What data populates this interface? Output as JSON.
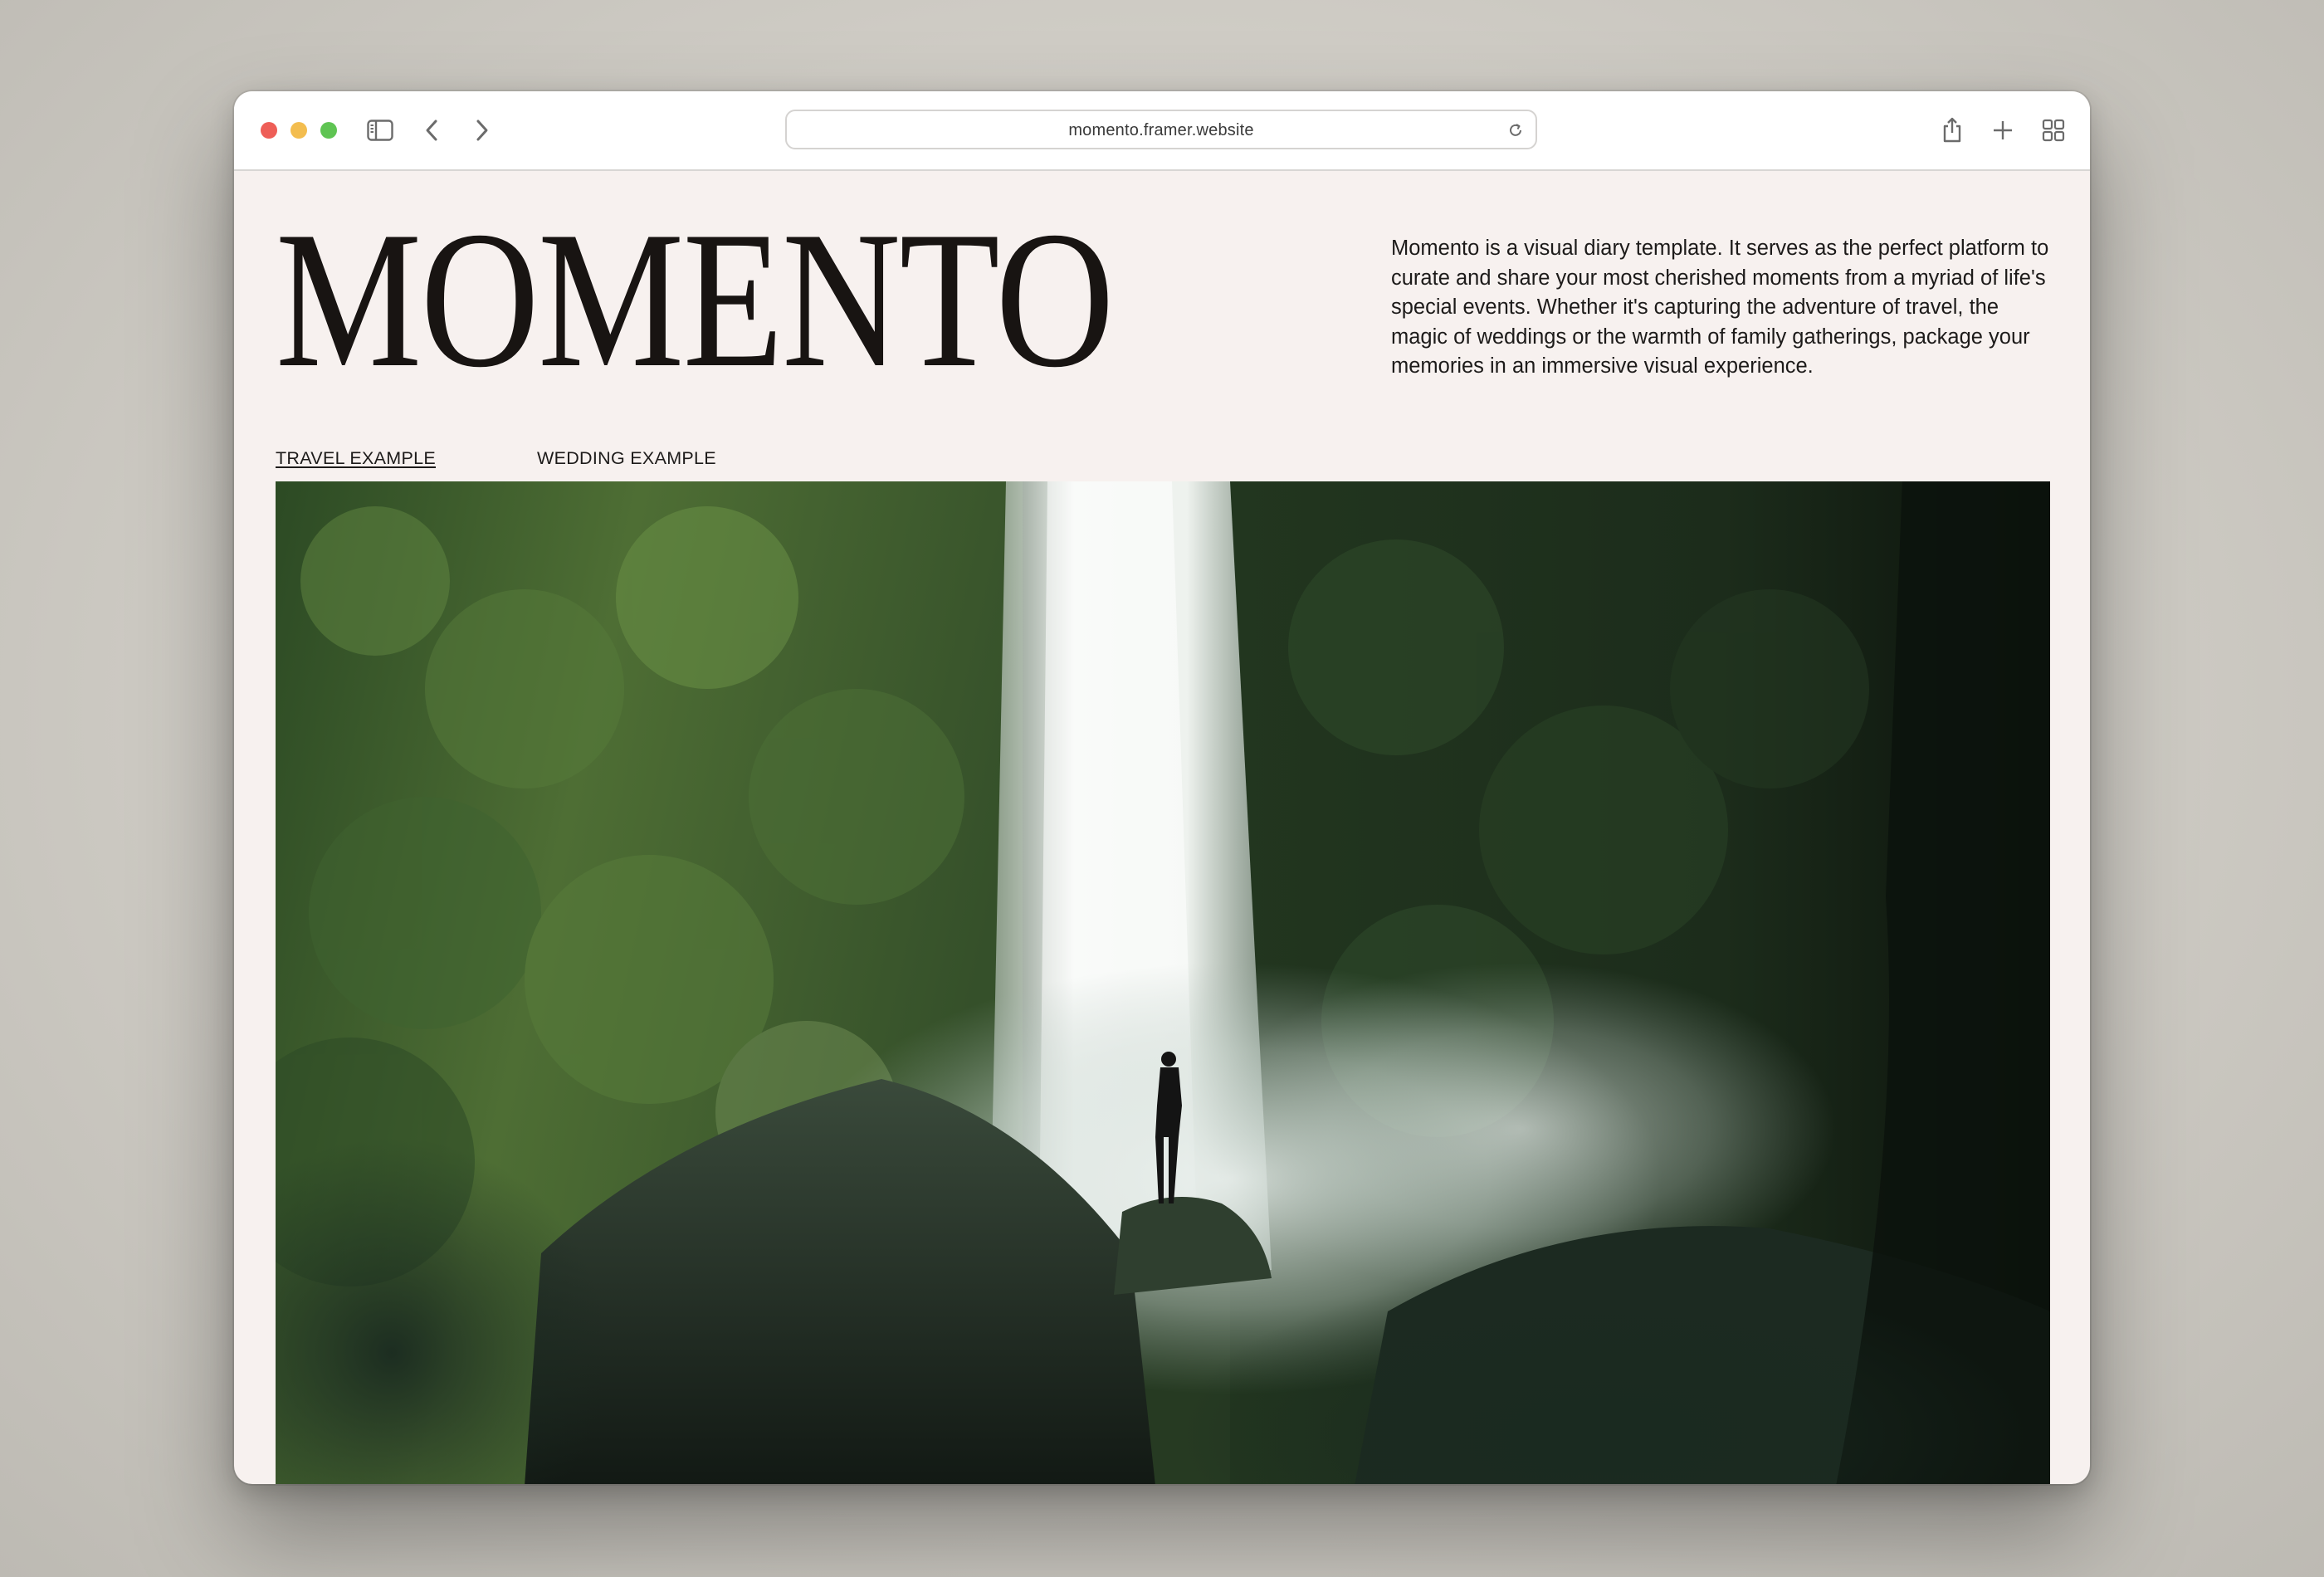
{
  "browser": {
    "url": "momento.framer.website"
  },
  "header": {
    "brand": "MOMENTO",
    "intro": "Momento is a visual diary template. It serves as the perfect platform to curate and share your most cherished moments from a myriad of life's special events. Whether it's capturing the adventure of travel, the magic of weddings or the warmth of family gatherings, package your memories in an immersive visual experience."
  },
  "nav": {
    "travel_label": "TRAVEL EXAMPLE",
    "wedding_label": "WEDDING EXAMPLE"
  },
  "hero": {
    "subject": "waterfall-photo"
  }
}
